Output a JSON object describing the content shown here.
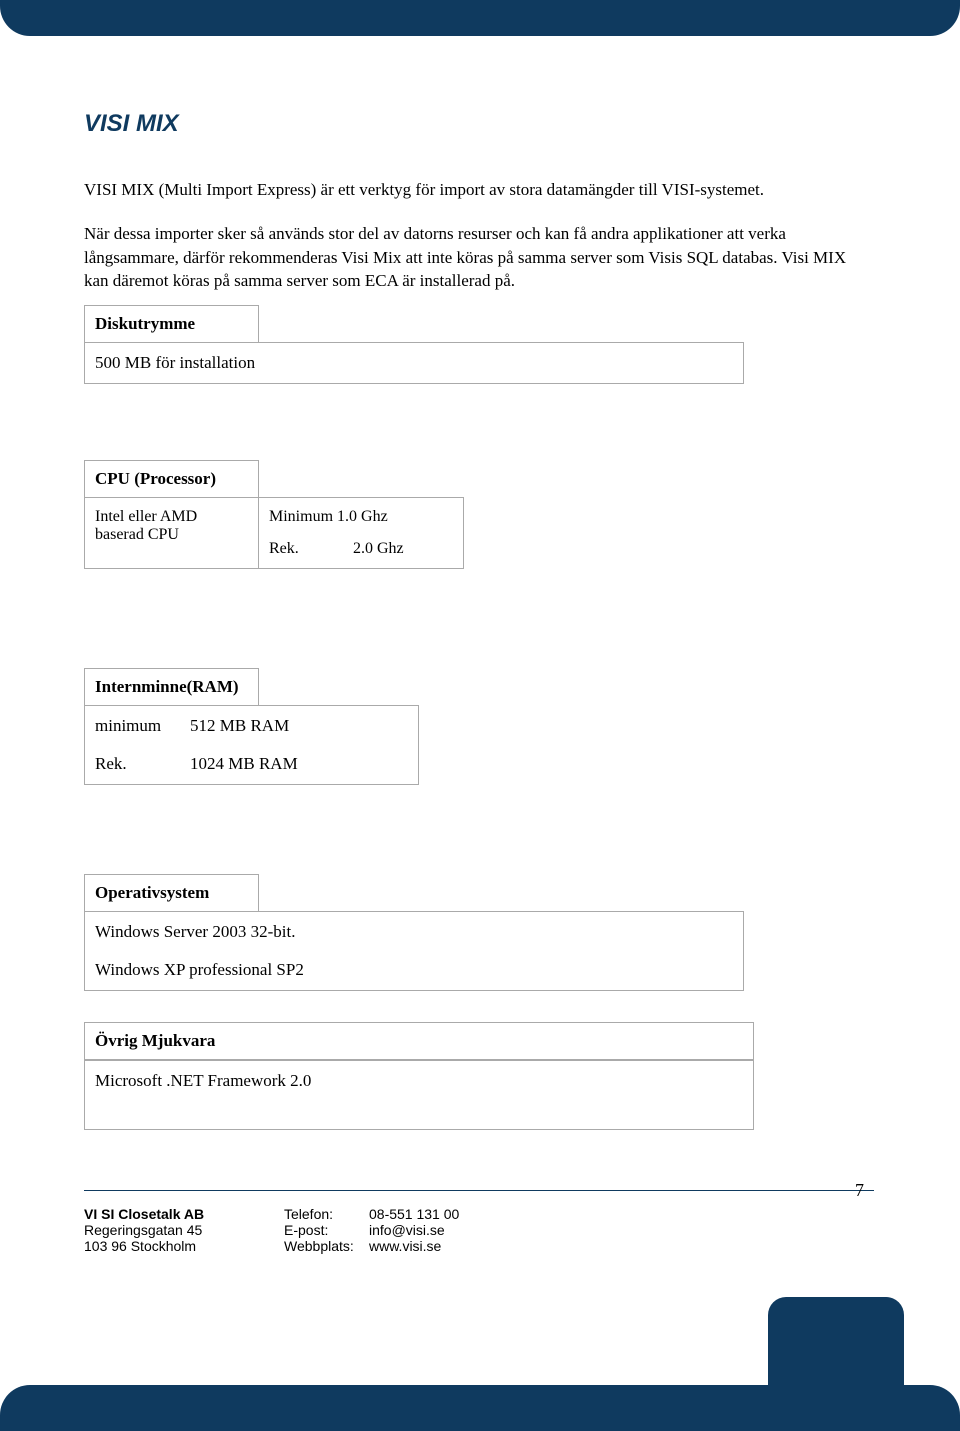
{
  "title": "VISI MIX",
  "intro": "VISI MIX (Multi Import Express) är ett verktyg för import av stora datamängder till VISI-systemet.",
  "desc": "När dessa importer sker så används stor del av datorns resurser och kan få andra applikationer att verka långsammare, därför rekommenderas Visi Mix att inte köras på samma server som Visis SQL databas. Visi MIX kan däremot köras på samma server som ECA är installerad på.",
  "disk": {
    "header": "Diskutrymme",
    "value": "500 MB för installation"
  },
  "cpu": {
    "header": "CPU (Processor)",
    "left": "Intel eller AMD baserad CPU",
    "min_label": "Minimum",
    "min_value": "1.0 Ghz",
    "rek_label": "Rek.",
    "rek_value": "2.0 Ghz"
  },
  "ram": {
    "header": "Internminne(RAM)",
    "min_label": "minimum",
    "min_value": "512   MB RAM",
    "rek_label": "Rek.",
    "rek_value": "1024 MB RAM"
  },
  "os": {
    "header": "Operativsystem",
    "line1": "Windows Server 2003 32-bit.",
    "line2": "Windows XP professional SP2"
  },
  "software": {
    "header": "Övrig Mjukvara",
    "line1": "Microsoft .NET Framework 2.0"
  },
  "footer": {
    "page": "7",
    "company": "VI SI Closetalk AB",
    "addr1": "Regeringsgatan 45",
    "addr2": "103 96 Stockholm",
    "tel_label": "Telefon:",
    "tel_value": "08-551 131 00",
    "email_label": "E-post:",
    "email_value": "info@visi.se",
    "web_label": "Webbplats:",
    "web_value": "www.visi.se"
  }
}
